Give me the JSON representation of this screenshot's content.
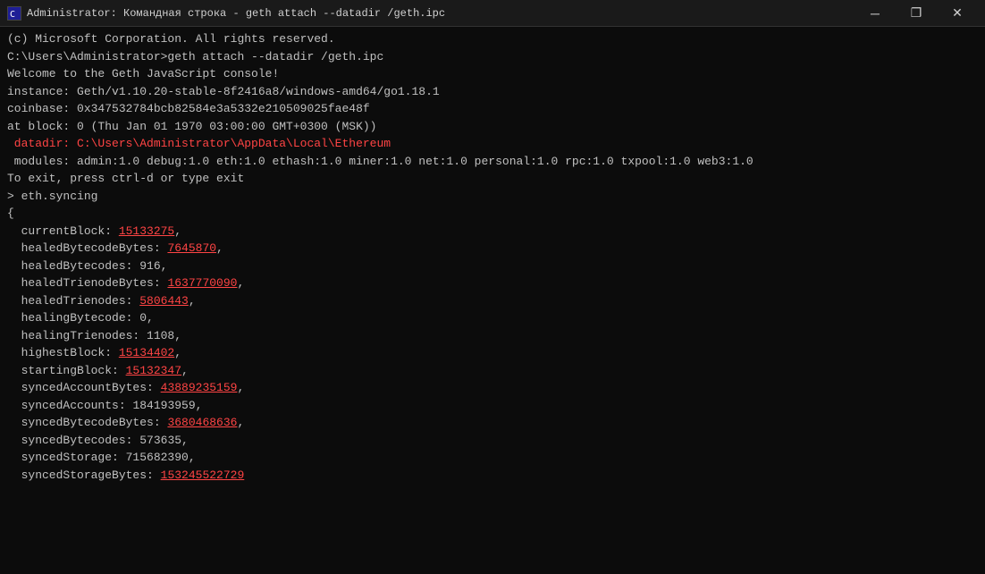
{
  "titleBar": {
    "title": "Administrator: Командная строка - geth  attach  --datadir /geth.ipc",
    "icon": "cmd",
    "minimizeLabel": "─",
    "restoreLabel": "❐",
    "closeLabel": "✕"
  },
  "terminal": {
    "lines": [
      {
        "id": "copyright",
        "text": "(c) Microsoft Corporation. All rights reserved.",
        "style": "normal"
      },
      {
        "id": "blank1",
        "text": "",
        "style": "normal"
      },
      {
        "id": "command",
        "text": "C:\\Users\\Administrator>geth attach --datadir /geth.ipc",
        "style": "normal"
      },
      {
        "id": "welcome",
        "text": "Welcome to the Geth JavaScript console!",
        "style": "normal"
      },
      {
        "id": "blank2",
        "text": "",
        "style": "normal"
      },
      {
        "id": "instance",
        "text": "instance: Geth/v1.10.20-stable-8f2416a8/windows-amd64/go1.18.1",
        "style": "normal"
      },
      {
        "id": "coinbase",
        "text": "coinbase: 0x347532784bcb82584e3a5332e210509025fae48f",
        "style": "normal"
      },
      {
        "id": "atblock",
        "text": "at block: 0 (Thu Jan 01 1970 03:00:00 GMT+0300 (MSK))",
        "style": "normal"
      },
      {
        "id": "datadir",
        "text": " datadir: C:\\Users\\Administrator\\AppData\\Local\\Ethereum",
        "style": "highlight"
      },
      {
        "id": "modules",
        "text": " modules: admin:1.0 debug:1.0 eth:1.0 ethash:1.0 miner:1.0 net:1.0 personal:1.0 rpc:1.0 txpool:1.0 web3:1.0",
        "style": "normal"
      },
      {
        "id": "blank3",
        "text": "",
        "style": "normal"
      },
      {
        "id": "exit_hint",
        "text": "To exit, press ctrl-d or type exit",
        "style": "normal"
      },
      {
        "id": "prompt_syncing",
        "text": "> eth.syncing",
        "style": "normal"
      },
      {
        "id": "open_brace",
        "text": "{",
        "style": "normal"
      },
      {
        "id": "currentBlock",
        "text": "  currentBlock: 15133275,",
        "style": "mixed",
        "parts": [
          {
            "text": "  currentBlock: ",
            "style": "normal"
          },
          {
            "text": "15133275",
            "style": "red"
          },
          {
            "text": ",",
            "style": "normal"
          }
        ]
      },
      {
        "id": "healedBytecodeBytes",
        "text": "  healedBytecodeBytes: 7645870,",
        "style": "mixed",
        "parts": [
          {
            "text": "  healedBytecodeBytes: ",
            "style": "normal"
          },
          {
            "text": "7645870",
            "style": "red"
          },
          {
            "text": ",",
            "style": "normal"
          }
        ]
      },
      {
        "id": "healedBytecodes",
        "text": "  healedBytecodes: 916,",
        "style": "mixed",
        "parts": [
          {
            "text": "  healedBytecodes: ",
            "style": "normal"
          },
          {
            "text": "916",
            "style": "normal"
          },
          {
            "text": ",",
            "style": "normal"
          }
        ]
      },
      {
        "id": "healedTrienodeBytes",
        "text": "  healedTrienodeBytes: 1637770090,",
        "style": "mixed",
        "parts": [
          {
            "text": "  healedTrienodeBytes: ",
            "style": "normal"
          },
          {
            "text": "1637770090",
            "style": "red"
          },
          {
            "text": ",",
            "style": "normal"
          }
        ]
      },
      {
        "id": "healedTrienodes",
        "text": "  healedTrienodes: 5806443,",
        "style": "mixed",
        "parts": [
          {
            "text": "  healedTrienodes: ",
            "style": "normal"
          },
          {
            "text": "5806443",
            "style": "red"
          },
          {
            "text": ",",
            "style": "normal"
          }
        ]
      },
      {
        "id": "healingBytecode",
        "text": "  healingBytecode: 0,",
        "style": "mixed",
        "parts": [
          {
            "text": "  healingBytecode: ",
            "style": "normal"
          },
          {
            "text": "0",
            "style": "normal"
          },
          {
            "text": ",",
            "style": "normal"
          }
        ]
      },
      {
        "id": "healingTrienodes",
        "text": "  healingTrienodes: 1108,",
        "style": "mixed",
        "parts": [
          {
            "text": "  healingTrienodes: ",
            "style": "normal"
          },
          {
            "text": "1108",
            "style": "normal"
          },
          {
            "text": ",",
            "style": "normal"
          }
        ]
      },
      {
        "id": "highestBlock",
        "text": "  highestBlock: 15134402,",
        "style": "mixed",
        "parts": [
          {
            "text": "  highestBlock: ",
            "style": "normal"
          },
          {
            "text": "15134402",
            "style": "red"
          },
          {
            "text": ",",
            "style": "normal"
          }
        ]
      },
      {
        "id": "startingBlock",
        "text": "  startingBlock: 15132347,",
        "style": "mixed",
        "parts": [
          {
            "text": "  startingBlock: ",
            "style": "normal"
          },
          {
            "text": "15132347",
            "style": "red"
          },
          {
            "text": ",",
            "style": "normal"
          }
        ]
      },
      {
        "id": "syncedAccountBytes",
        "text": "  syncedAccountBytes: 43889235159,",
        "style": "mixed",
        "parts": [
          {
            "text": "  syncedAccountBytes: ",
            "style": "normal"
          },
          {
            "text": "43889235159",
            "style": "red"
          },
          {
            "text": ",",
            "style": "normal"
          }
        ]
      },
      {
        "id": "syncedAccounts",
        "text": "  syncedAccounts: 184193959,",
        "style": "mixed",
        "parts": [
          {
            "text": "  syncedAccounts: ",
            "style": "normal"
          },
          {
            "text": "184193959",
            "style": "normal"
          },
          {
            "text": ",",
            "style": "normal"
          }
        ]
      },
      {
        "id": "syncedBytecodeBytes",
        "text": "  syncedBytecodeBytes: 3680468636,",
        "style": "mixed",
        "parts": [
          {
            "text": "  syncedBytecodeBytes: ",
            "style": "normal"
          },
          {
            "text": "3680468636",
            "style": "red"
          },
          {
            "text": ",",
            "style": "normal"
          }
        ]
      },
      {
        "id": "syncedBytecodes",
        "text": "  syncedBytecodes: 573635,",
        "style": "mixed",
        "parts": [
          {
            "text": "  syncedBytecodes: ",
            "style": "normal"
          },
          {
            "text": "573635",
            "style": "normal"
          },
          {
            "text": ",",
            "style": "normal"
          }
        ]
      },
      {
        "id": "syncedStorage",
        "text": "  syncedStorage: 715682390,",
        "style": "mixed",
        "parts": [
          {
            "text": "  syncedStorage: ",
            "style": "normal"
          },
          {
            "text": "715682390",
            "style": "normal"
          },
          {
            "text": ",",
            "style": "normal"
          }
        ]
      },
      {
        "id": "syncedStorageBytes",
        "text": "  syncedStorageBytes: 153245522729",
        "style": "mixed",
        "parts": [
          {
            "text": "  syncedStorageBytes: ",
            "style": "normal"
          },
          {
            "text": "153245522729",
            "style": "red"
          },
          {
            "text": "",
            "style": "normal"
          }
        ]
      }
    ]
  }
}
